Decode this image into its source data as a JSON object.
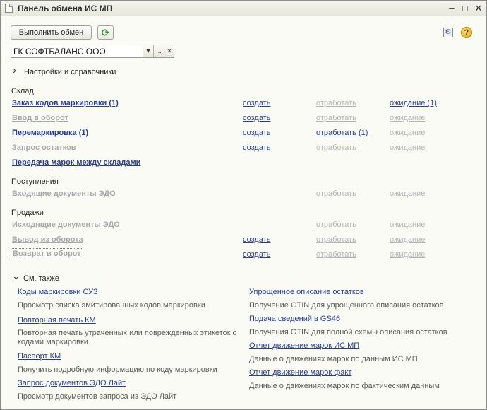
{
  "window": {
    "title": "Панель обмена ИС МП",
    "minimize_glyph": "–",
    "maximize_glyph": "□",
    "close_glyph": "✕"
  },
  "toolbar": {
    "exchange_button": "Выполнить обмен",
    "refresh_glyph": "⟳",
    "settings_glyph": "⚙",
    "help_glyph": "?"
  },
  "organization": {
    "value": "ГК СОФТБАЛАНС ООО",
    "dropdown_glyph": "▼",
    "choose_glyph": "...",
    "clear_glyph": "✕"
  },
  "settings_group": {
    "chevron": "›",
    "label": "Настройки и справочники"
  },
  "sections": {
    "warehouse": {
      "label": "Склад",
      "rows": [
        {
          "name": "Заказ кодов маркировки (1)",
          "create": "создать",
          "process": "отработать",
          "wait": "ожидание (1)"
        },
        {
          "name": "Ввод в оборот",
          "create": "создать",
          "process": "отработать",
          "wait": "ожидание"
        },
        {
          "name": "Перемаркировка (1)",
          "create": "создать",
          "process": "отработать (1)",
          "wait": "ожидание"
        },
        {
          "name": "Запрос остатков",
          "create": "создать",
          "process": "отработать",
          "wait": "ожидание"
        },
        {
          "name": "Передача марок между складами"
        }
      ]
    },
    "receipts": {
      "label": "Поступления",
      "rows": [
        {
          "name": "Входящие документы ЭДО",
          "process": "отработать",
          "wait": "ожидание"
        }
      ]
    },
    "sales": {
      "label": "Продажи",
      "rows": [
        {
          "name": "Исходящие документы ЭДО",
          "process": "отработать",
          "wait": "ожидание"
        },
        {
          "name": "Вывод из оборота",
          "create": "создать",
          "process": "отработать",
          "wait": "ожидание"
        },
        {
          "name": "Возврат в оборот",
          "create": "создать",
          "process": "отработать",
          "wait": "ожидание"
        }
      ]
    }
  },
  "see_also": {
    "chevron": "⌄",
    "label": "См. также",
    "left": [
      {
        "link": "Коды маркировки СУЗ",
        "desc": "Просмотр списка эмитированных кодов маркировки"
      },
      {
        "link": "Повторная печать КМ",
        "desc": "Повторная печать утраченных или поврежденных этикеток с кодами маркировки"
      },
      {
        "link": "Паспорт КМ",
        "desc": "Получить подробную информацию по коду маркировки"
      },
      {
        "link": "Запрос документов ЭДО Лайт",
        "desc": "Просмотр документов запроса из ЭДО Лайт"
      }
    ],
    "right": [
      {
        "link": "Упрощенное описание остатков",
        "desc": "Получение GTIN для упрощенного описания остатков"
      },
      {
        "link": "Подача сведений в GS46",
        "desc": "Получения GTIN для полной схемы описания остатков"
      },
      {
        "link": "Отчет движение марок ИС МП",
        "desc": "Данные о движениях марок по данным ИС МП"
      },
      {
        "link": "Отчет движение марок факт",
        "desc": "Данные о движениях марок по фактическим данным"
      }
    ]
  }
}
